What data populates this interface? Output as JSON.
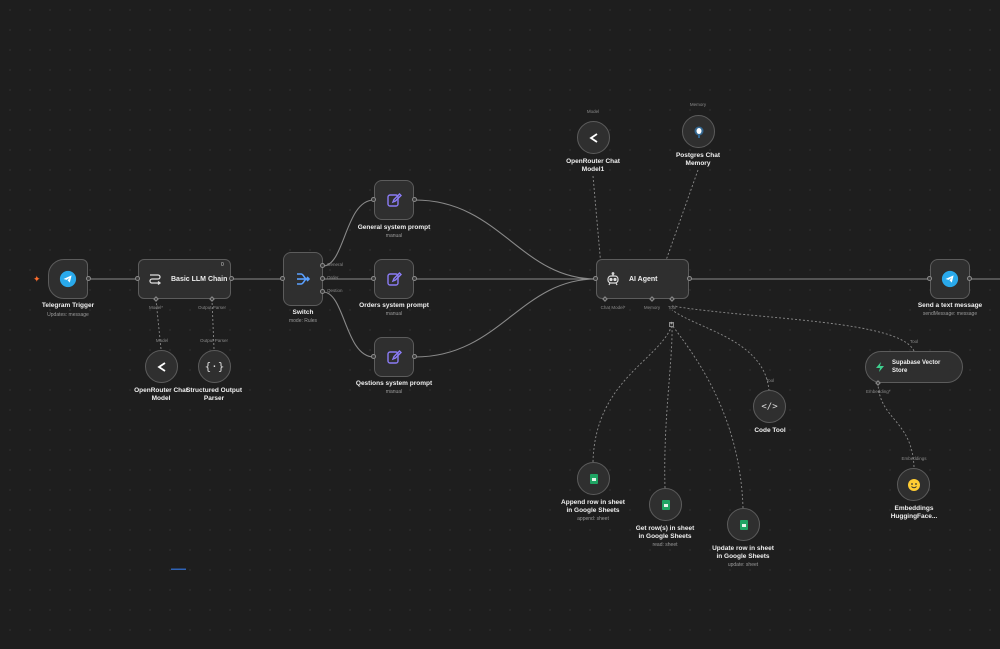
{
  "nodes": {
    "telegram_trigger": {
      "title": "Telegram Trigger",
      "subtitle": "Updates: message",
      "icon": "telegram-icon"
    },
    "basic_llm_chain": {
      "title": "Basic LLM Chain",
      "badge": "0",
      "port_model": "Model*",
      "port_parser": "Output Parser",
      "icon": "chain-icon"
    },
    "openrouter_model": {
      "title": "OpenRouter Chat Model",
      "port_label": "Model",
      "icon": "openrouter-icon"
    },
    "structured_parser": {
      "title": "Structured Output Parser",
      "port_label": "Output Parser",
      "icon": "braces-icon"
    },
    "switch": {
      "title": "Switch",
      "subtitle": "mode: Rules",
      "outputs": [
        "General",
        "Order",
        "Qestion"
      ],
      "icon": "switch-icon"
    },
    "general_prompt": {
      "title": "General system prompt",
      "subtitle": "manual",
      "icon": "edit-icon"
    },
    "orders_prompt": {
      "title": "Orders system prompt",
      "subtitle": "manual",
      "icon": "edit-icon"
    },
    "questions_prompt": {
      "title": "Qestions system prompt",
      "subtitle": "manual",
      "icon": "edit-icon"
    },
    "openrouter_model1": {
      "title": "OpenRouter Chat Model1",
      "port_label": "Model",
      "icon": "openrouter-icon"
    },
    "postgres_memory": {
      "title": "Postgres Chat Memory",
      "port_label": "Memory",
      "icon": "postgres-icon"
    },
    "ai_agent": {
      "title": "AI Agent",
      "port_chat": "Chat Model*",
      "port_memory": "Memory",
      "port_tool": "Tool",
      "icon": "robot-icon"
    },
    "send_message": {
      "title": "Send a text message",
      "subtitle": "sendMessage: message",
      "icon": "telegram-icon"
    },
    "supabase": {
      "title": "Supabase Vector Store",
      "port_label": "Tool",
      "port_embedding": "Embedding*",
      "icon": "supabase-icon"
    },
    "code_tool": {
      "title": "Code Tool",
      "port_label": "Tool",
      "icon": "code-icon"
    },
    "embeddings": {
      "title": "Embeddings HuggingFace...",
      "port_label": "Embeddings",
      "icon": "huggingface-icon"
    },
    "append_row": {
      "title": "Append row in sheet in Google Sheets",
      "subtitle": "append: sheet",
      "icon": "google-sheets-icon"
    },
    "get_rows": {
      "title": "Get row(s) in sheet in Google Sheets",
      "subtitle": "read: sheet",
      "icon": "google-sheets-icon"
    },
    "update_row": {
      "title": "Update row in sheet in Google Sheets",
      "subtitle": "update: sheet",
      "icon": "google-sheets-icon"
    }
  },
  "colors": {
    "canvas": "#1e1e1e",
    "node_bg": "#2f2f2f",
    "edge": "#8a8a8a",
    "telegram": "#29a9eb",
    "sheets": "#1fa463",
    "supabase": "#3ecf8e",
    "accent_purple": "#8b7cf6",
    "trigger_marker": "#ff6d2d"
  }
}
